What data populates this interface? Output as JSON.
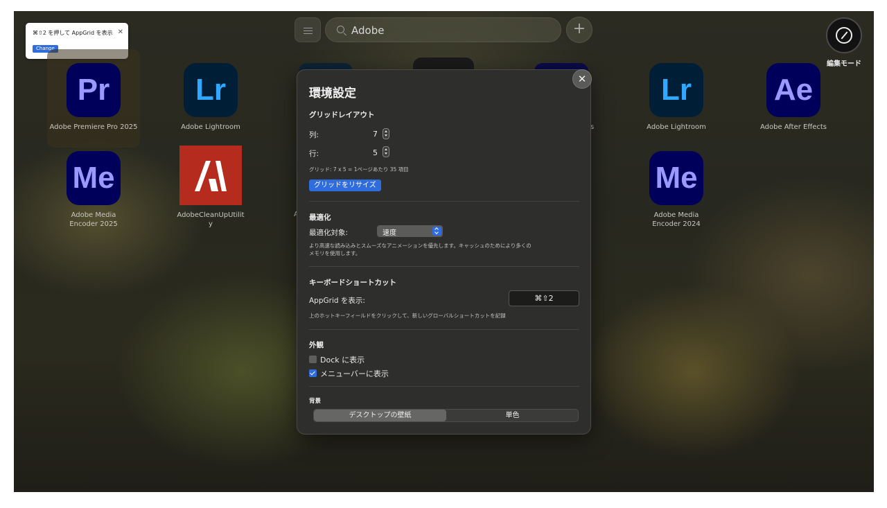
{
  "toast": {
    "message": "⌘⇧2 を押して AppGrid を表示",
    "close": "✕",
    "change_label": "Change"
  },
  "topbar": {
    "search_value": "Adobe",
    "add": "+"
  },
  "edit_mode": {
    "label": "編集モード"
  },
  "apps": [
    {
      "abbr": "Pr",
      "name": "Adobe Premiere Pro 2025"
    },
    {
      "abbr": "Lr",
      "name": "Adobe Lightroom"
    },
    {
      "abbr": "Lr",
      "name": "Adobe Lightroom"
    },
    {
      "abbr": "Ae",
      "name": "Adobe After Effects"
    },
    {
      "abbr": "Me",
      "name": "Adobe Media Encoder 2025"
    },
    {
      "abbr": "",
      "name": "AdobeCleanUpUtility"
    },
    {
      "abbr": "Me",
      "name": "Adobe Media Encoder 2024"
    }
  ],
  "partial_text": {
    "left_a": "A",
    "right_s": "s"
  },
  "dialog": {
    "close": "✕",
    "title": "環境設定",
    "grid": {
      "heading": "グリッドレイアウト",
      "cols_label": "列:",
      "cols_value": "7",
      "rows_label": "行:",
      "rows_value": "5",
      "summary": "グリッド: 7 x 5 = 1ページあたり 35 項目",
      "resize_button": "グリッドをリサイズ"
    },
    "optimize": {
      "heading": "最適化",
      "target_label": "最適化対象:",
      "target_value": "速度",
      "desc_line1": "より高速な読み込みとスムーズなアニメーションを優先します。キャッシュのためにより多くの",
      "desc_line2": "メモリを使用します。"
    },
    "shortcut": {
      "heading": "キーボードショートカット",
      "label": "AppGrid を表示:",
      "hotkey": "⌘⇧2",
      "hint": "上のホットキーフィールドをクリックして、新しいグローバルショートカットを記録"
    },
    "appearance": {
      "heading": "外観",
      "dock_label": "Dock に表示",
      "dock_checked": false,
      "menubar_label": "メニューバーに表示",
      "menubar_checked": true
    },
    "background": {
      "heading": "背景",
      "option_wallpaper": "デスクトップの壁紙",
      "option_solid": "単色",
      "selected": "デスクトップの壁紙"
    }
  }
}
